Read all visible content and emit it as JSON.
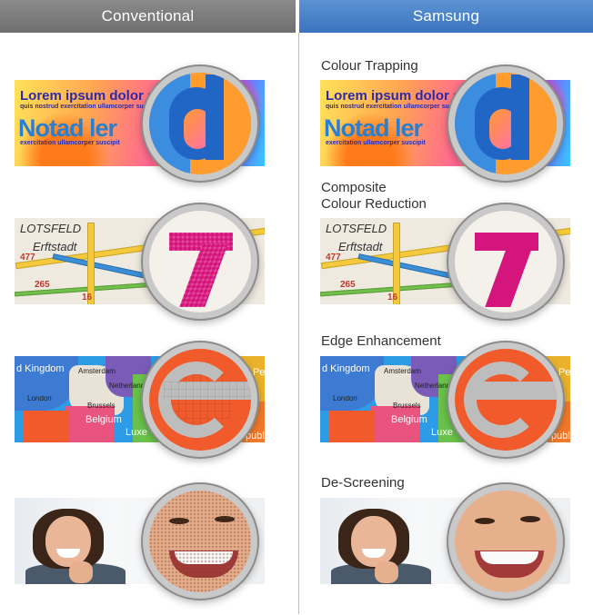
{
  "header": {
    "left_title": "Conventional",
    "right_title": "Samsung"
  },
  "colors": {
    "left_header": "#777777",
    "right_header": "#4a84c8"
  },
  "features": [
    {
      "label_line1": "Colour Trapping",
      "label_line2": ""
    },
    {
      "label_line1": "Composite",
      "label_line2": "Colour Reduction"
    },
    {
      "label_line1": "Edge Enhancement",
      "label_line2": ""
    },
    {
      "label_line1": "De-Screening",
      "label_line2": ""
    }
  ],
  "banner1": {
    "headline": "Lorem ipsum dolor sit met",
    "subline": "quis nostrud exercitation ullamcorper suscipit",
    "brand": "Notad ler",
    "brand_sub": "exercitation ullamcorper suscipit"
  },
  "banner2": {
    "place1": "LOTSFELD",
    "place2": "Erftstadt",
    "num1": "477",
    "num2": "265",
    "num3": "16"
  },
  "banner3": {
    "country1": "d Kingdom",
    "city1": "Amsterdam",
    "country2": "Netherlands",
    "city2": "London",
    "city3": "Brussels",
    "country3": "Belgium",
    "country4": "Luxe",
    "country5": "Republ",
    "edge": "Pe"
  }
}
